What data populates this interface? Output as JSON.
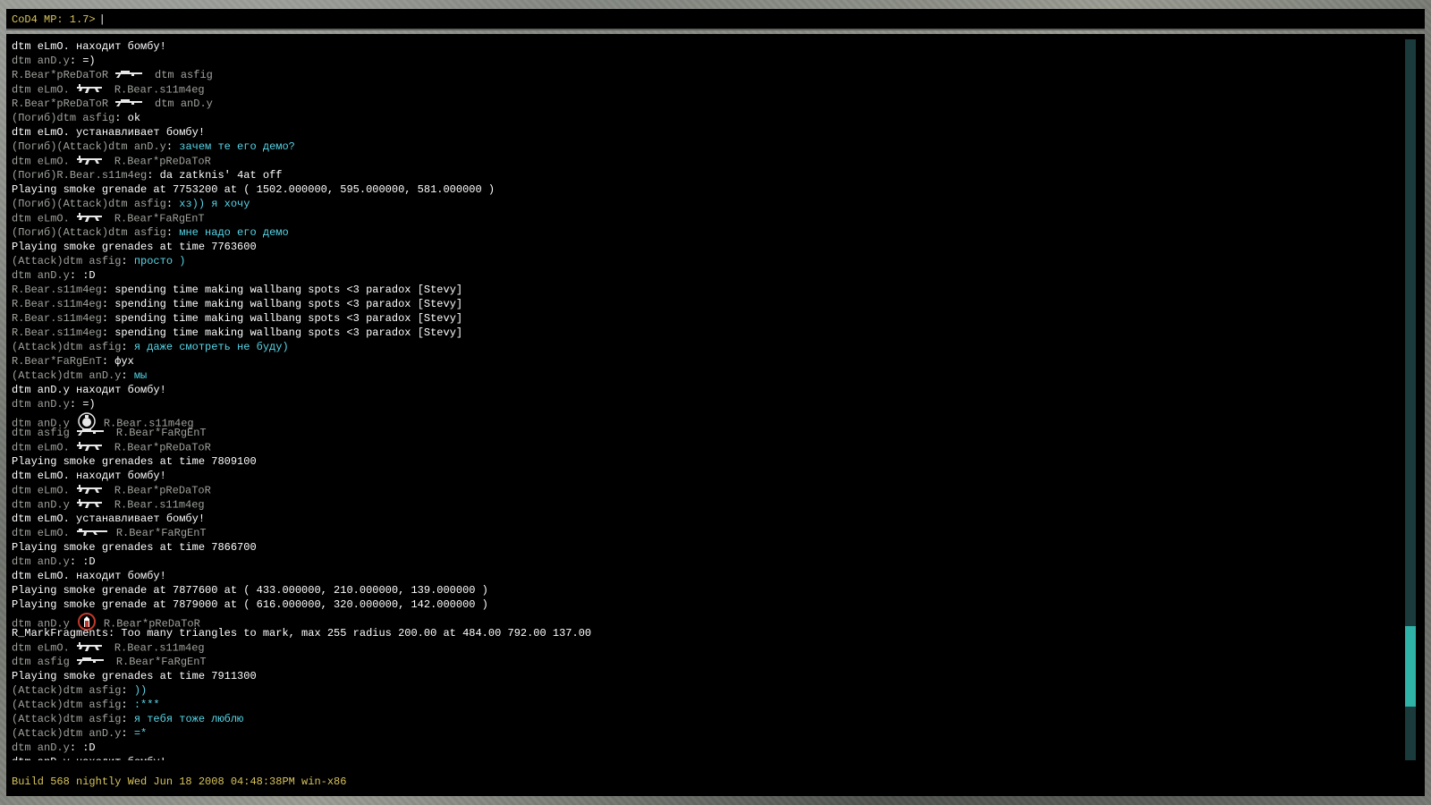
{
  "prompt": {
    "label": "CoD4 MP: 1.7>",
    "cursor": "|"
  },
  "build_info": "Build 568 nightly Wed Jun 18 2008 04:48:38PM win-x86",
  "colors": {
    "accent": "#d8c35a",
    "chat_cyan": "#56d6e8",
    "gray_name": "#9fa39c",
    "console_bg": "#000000",
    "scroll_thumb": "#2fb2a8"
  },
  "log": [
    {
      "type": "sys",
      "text": "dtm eLmO. находит бомбу!"
    },
    {
      "type": "chat",
      "prefix": "",
      "name": "dtm anD.y",
      "msg": "=)",
      "msg_color": "white"
    },
    {
      "type": "kill",
      "killer": "R.Bear*pReDaToR",
      "weapon": "sniper-rifle-icon",
      "victim": "dtm asfig"
    },
    {
      "type": "kill",
      "killer": "dtm eLmO.",
      "weapon": "ak47-icon",
      "victim": "R.Bear.s11m4eg"
    },
    {
      "type": "kill",
      "killer": "R.Bear*pReDaToR",
      "weapon": "sniper-rifle-icon",
      "victim": "dtm anD.y"
    },
    {
      "type": "chat",
      "prefix": "(Погиб)",
      "name": "dtm asfig",
      "msg": "ok",
      "msg_color": "white"
    },
    {
      "type": "sys",
      "text": "dtm eLmO. устанавливает бомбу!"
    },
    {
      "type": "chat",
      "prefix": "(Погиб)(Attack)",
      "name": "dtm anD.y",
      "msg": "зачем те его демо?",
      "msg_color": "cyan"
    },
    {
      "type": "kill",
      "killer": "dtm eLmO.",
      "weapon": "ak47-icon",
      "victim": "R.Bear*pReDaToR"
    },
    {
      "type": "chat",
      "prefix": "(Погиб)",
      "name": "R.Bear.s11m4eg",
      "msg": "da zatknis' 4at off",
      "msg_color": "white"
    },
    {
      "type": "sys",
      "text": "Playing smoke grenade at 7753200 at ( 1502.000000, 595.000000, 581.000000 )"
    },
    {
      "type": "chat",
      "prefix": "(Погиб)(Attack)",
      "name": "dtm asfig",
      "msg": "хз)) я хочу",
      "msg_color": "cyan"
    },
    {
      "type": "kill",
      "killer": "dtm eLmO.",
      "weapon": "ak47-icon",
      "victim": "R.Bear*FaRgEnT"
    },
    {
      "type": "chat",
      "prefix": "(Погиб)(Attack)",
      "name": "dtm asfig",
      "msg": "мне надо его демо",
      "msg_color": "cyan"
    },
    {
      "type": "sys",
      "text": "Playing smoke grenades at time 7763600"
    },
    {
      "type": "chat",
      "prefix": "(Attack)",
      "name": "dtm asfig",
      "msg": "просто )",
      "msg_color": "cyan"
    },
    {
      "type": "chat",
      "prefix": "",
      "name": "dtm anD.y",
      "msg": ":D",
      "msg_color": "white"
    },
    {
      "type": "chat",
      "prefix": "",
      "name": "R.Bear.s11m4eg",
      "msg": "spending time making wallbang spots <3 paradox [Stevy]",
      "msg_color": "white"
    },
    {
      "type": "chat",
      "prefix": "",
      "name": "R.Bear.s11m4eg",
      "msg": "spending time making wallbang spots <3 paradox [Stevy]",
      "msg_color": "white"
    },
    {
      "type": "chat",
      "prefix": "",
      "name": "R.Bear.s11m4eg",
      "msg": "spending time making wallbang spots <3 paradox [Stevy]",
      "msg_color": "white"
    },
    {
      "type": "chat",
      "prefix": "",
      "name": "R.Bear.s11m4eg",
      "msg": "spending time making wallbang spots <3 paradox [Stevy]",
      "msg_color": "white"
    },
    {
      "type": "chat",
      "prefix": "(Attack)",
      "name": "dtm asfig",
      "msg": "я даже смотреть не буду)",
      "msg_color": "cyan"
    },
    {
      "type": "chat",
      "prefix": "",
      "name": "R.Bear*FaRgEnT",
      "msg": "фух",
      "msg_color": "white"
    },
    {
      "type": "chat",
      "prefix": "(Attack)",
      "name": "dtm anD.y",
      "msg": "мы",
      "msg_color": "cyan"
    },
    {
      "type": "sys",
      "text": "dtm anD.y находит бомбу!"
    },
    {
      "type": "chat",
      "prefix": "",
      "name": "dtm anD.y",
      "msg": "=)",
      "msg_color": "white"
    },
    {
      "type": "kill",
      "killer": "dtm anD.y",
      "weapon": "grenade-icon",
      "victim": "R.Bear.s11m4eg"
    },
    {
      "type": "kill",
      "killer": "dtm asfig",
      "weapon": "sniper-rifle-icon",
      "victim": "R.Bear*FaRgEnT"
    },
    {
      "type": "kill",
      "killer": "dtm eLmO.",
      "weapon": "ak47-icon",
      "victim": "R.Bear*pReDaToR"
    },
    {
      "type": "sys",
      "text": "Playing smoke grenades at time 7809100"
    },
    {
      "type": "sys",
      "text": "dtm eLmO. находит бомбу!"
    },
    {
      "type": "kill",
      "killer": "dtm eLmO.",
      "weapon": "ak47-icon",
      "victim": "R.Bear*pReDaToR"
    },
    {
      "type": "kill",
      "killer": "dtm anD.y",
      "weapon": "ak47-icon",
      "victim": "R.Bear.s11m4eg"
    },
    {
      "type": "sys",
      "text": "dtm eLmO. устанавливает бомбу!"
    },
    {
      "type": "kill",
      "killer": "dtm eLmO.",
      "weapon": "assault-rifle-icon",
      "victim": "R.Bear*FaRgEnT"
    },
    {
      "type": "sys",
      "text": "Playing smoke grenades at time 7866700"
    },
    {
      "type": "chat",
      "prefix": "",
      "name": "dtm anD.y",
      "msg": ":D",
      "msg_color": "white"
    },
    {
      "type": "sys",
      "text": "dtm eLmO. находит бомбу!"
    },
    {
      "type": "sys",
      "text": "Playing smoke grenade at 7877600 at ( 433.000000, 210.000000, 139.000000 )"
    },
    {
      "type": "sys",
      "text": "Playing smoke grenade at 7879000 at ( 616.000000, 320.000000, 142.000000 )"
    },
    {
      "type": "kill",
      "killer": "dtm anD.y",
      "weapon": "explosion-icon",
      "victim": "R.Bear*pReDaToR"
    },
    {
      "type": "sys",
      "text": "R_MarkFragments: Too many triangles to mark, max 255 radius 200.00 at 484.00 792.00 137.00"
    },
    {
      "type": "kill",
      "killer": "dtm eLmO.",
      "weapon": "ak47-icon",
      "victim": "R.Bear.s11m4eg"
    },
    {
      "type": "kill",
      "killer": "dtm asfig",
      "weapon": "sniper-rifle-icon",
      "victim": "R.Bear*FaRgEnT"
    },
    {
      "type": "sys",
      "text": "Playing smoke grenades at time 7911300"
    },
    {
      "type": "chat",
      "prefix": "(Attack)",
      "name": "dtm asfig",
      "msg": "))",
      "msg_color": "cyan"
    },
    {
      "type": "chat",
      "prefix": "(Attack)",
      "name": "dtm asfig",
      "msg": ":***",
      "msg_color": "cyan"
    },
    {
      "type": "chat",
      "prefix": "(Attack)",
      "name": "dtm asfig",
      "msg": "я тебя тоже люблю",
      "msg_color": "cyan"
    },
    {
      "type": "chat",
      "prefix": "(Attack)",
      "name": "dtm anD.y",
      "msg": "=*",
      "msg_color": "cyan"
    },
    {
      "type": "chat",
      "prefix": "",
      "name": "dtm anD.y",
      "msg": ":D",
      "msg_color": "white"
    },
    {
      "type": "sys",
      "text": "dtm anD.y находит бомбу!"
    }
  ]
}
